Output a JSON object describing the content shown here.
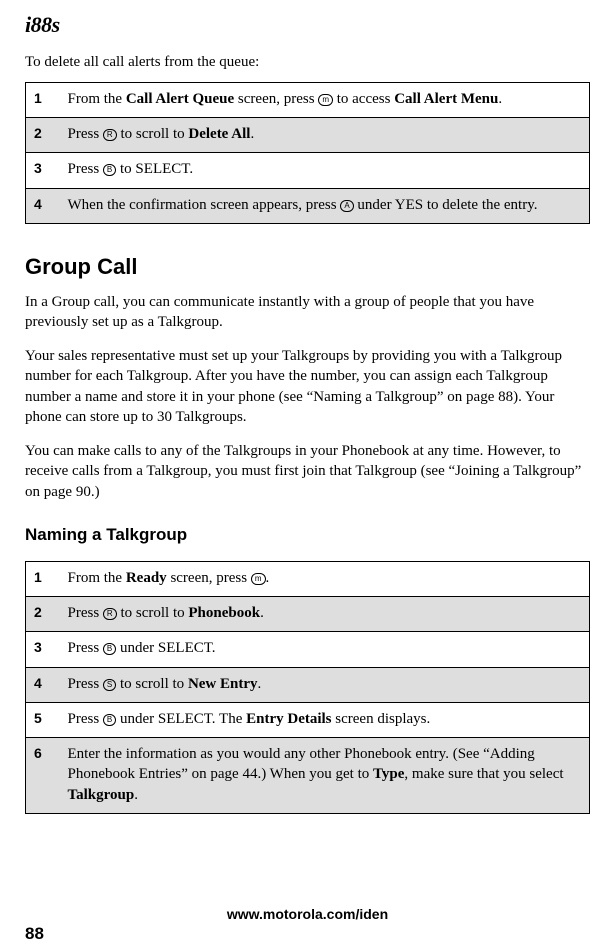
{
  "header": {
    "model": "i88s"
  },
  "intro1": "To delete all call alerts from the queue:",
  "table1": {
    "rows": [
      {
        "n": "1",
        "prefix": "From the ",
        "bold1": "Call Alert Queue",
        "mid": " screen, press ",
        "icon": "m",
        "mid2": " to access ",
        "bold2": "Call Alert Menu",
        "suffix": "."
      },
      {
        "n": "2",
        "prefix": "Press ",
        "icon": "R",
        "mid": " to scroll to ",
        "bold1": "Delete All",
        "suffix": "."
      },
      {
        "n": "3",
        "prefix": "Press ",
        "icon": "B",
        "mid": " to SELECT."
      },
      {
        "n": "4",
        "prefix": "When the confirmation screen appears, press ",
        "icon": "A",
        "mid": " under YES to delete the entry."
      }
    ]
  },
  "h2": "Group Call",
  "p1": "In a Group call, you can communicate instantly with a group of people that you have previously set up as a Talkgroup.",
  "p2": "Your sales representative must set up your Talkgroups by providing you with a Talkgroup number for each Talkgroup. After you have the number, you can assign each Talkgroup number a name and store it in your phone (see “Naming a Talkgroup” on page 88). Your phone can store up to 30 Talkgroups.",
  "p3": "You can make calls to any of the Talkgroups in your Phonebook at any time. However, to receive calls from a Talkgroup, you must first join that Talkgroup (see “Joining a Talkgroup” on page 90.)",
  "h3": "Naming a Talkgroup",
  "table2": {
    "rows": [
      {
        "n": "1",
        "prefix": "From the ",
        "bold1": "Ready",
        "mid": " screen, press ",
        "icon": "m",
        "suffix": "."
      },
      {
        "n": "2",
        "prefix": "Press ",
        "icon": "R",
        "mid": " to scroll to ",
        "bold1": "Phonebook",
        "suffix": "."
      },
      {
        "n": "3",
        "prefix": "Press ",
        "icon": "B",
        "mid": " under SELECT."
      },
      {
        "n": "4",
        "prefix": "Press ",
        "icon": "S",
        "mid": " to scroll to ",
        "bold1": "New Entry",
        "suffix": "."
      },
      {
        "n": "5",
        "prefix": "Press ",
        "icon": "B",
        "mid": " under SELECT. The ",
        "bold1": "Entry Details",
        "suffix": " screen displays."
      },
      {
        "n": "6",
        "prefix": "Enter the information as you would any other Phonebook entry. (See “Adding Phonebook Entries” on page 44.) When you get to ",
        "bold1": "Type",
        "mid": ", make sure that you select ",
        "bold2": "Talkgroup",
        "suffix": "."
      }
    ]
  },
  "footer": "www.motorola.com/iden",
  "pagenum": "88"
}
